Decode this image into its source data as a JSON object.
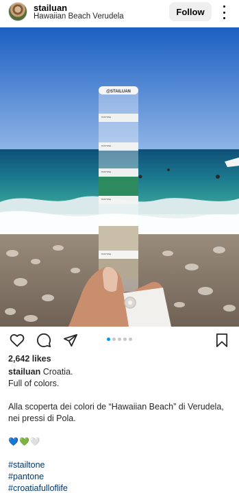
{
  "post": {
    "username": "stailuan",
    "location": "Hawaiian Beach Verudela",
    "follow_label": "Follow"
  },
  "photo": {
    "card_brand": "@STAILUAN",
    "swatch_label": "PANTONE",
    "colors": {
      "sky_top": "#1b5fc2",
      "sky_bottom": "#8fb4e6",
      "sea_dark": "#0e4f78",
      "sea_turquoise": "#2a9b8e",
      "swatch_green": "#2c8a5e",
      "swatch_beige": "#c9bfa8",
      "swatch_taupe": "#b3a892"
    }
  },
  "actions": {
    "like_icon": "heart-icon",
    "comment_icon": "comment-icon",
    "share_icon": "share-icon",
    "save_icon": "bookmark-icon",
    "carousel_count": 5,
    "carousel_active": 1
  },
  "likes_text": "2,642 likes",
  "caption": {
    "username": "stailuan",
    "line1": "Croatia.",
    "line2": "Full of colors.",
    "line3": "Alla scoperta dei colori de “Hawaiian Beach” di Verudela,",
    "line4": "nei pressi di Pola.",
    "emojis": "💙💚🤍",
    "hashtags": [
      "#stailtone",
      "#pantone",
      "#croatiafulloflife"
    ]
  }
}
